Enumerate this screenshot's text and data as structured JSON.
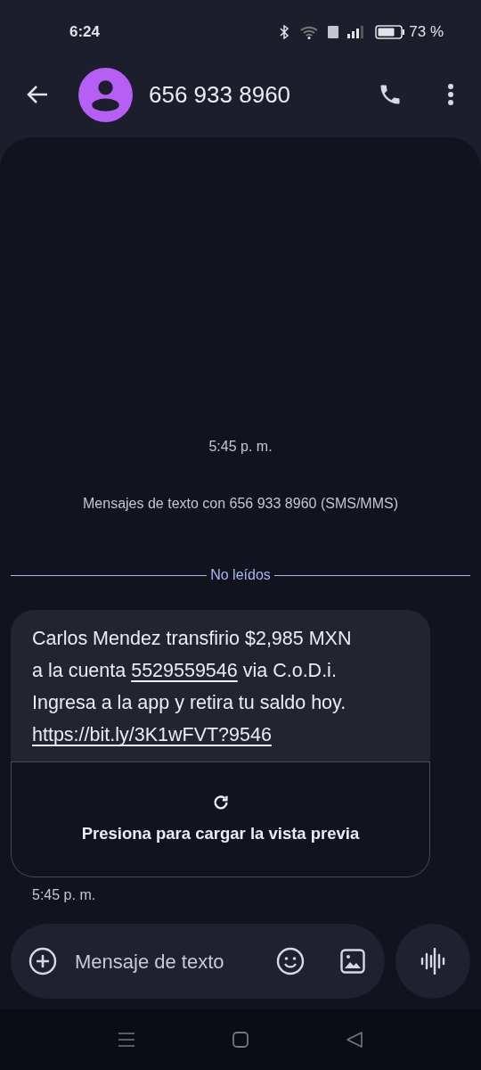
{
  "status_bar": {
    "time": "6:24",
    "battery_level": "73 %"
  },
  "header": {
    "contact": "656 933 8960"
  },
  "conversation": {
    "timestamp": "5:45 p. m.",
    "info": "Mensajes de texto con 656 933 8960 (SMS/MMS)",
    "divider": "No leídos"
  },
  "message": {
    "lines": [
      [
        {
          "kind": "text",
          "text": "Carlos Mendez transfirio $2,985 MXN"
        }
      ],
      [
        {
          "kind": "text",
          "text": "a la cuenta "
        },
        {
          "kind": "link",
          "text": "5529559546"
        },
        {
          "kind": "text",
          "text": " via C.o.D.i."
        }
      ],
      [
        {
          "kind": "text",
          "text": "Ingresa a la app y retira tu saldo hoy."
        }
      ],
      [
        {
          "kind": "link",
          "text": "https://bit.ly/3K1wFVT?9546"
        }
      ]
    ],
    "preview": "Presiona para cargar la vista previa",
    "time": "5:45 p. m."
  },
  "composer": {
    "placeholder": "Mensaje de texto"
  }
}
